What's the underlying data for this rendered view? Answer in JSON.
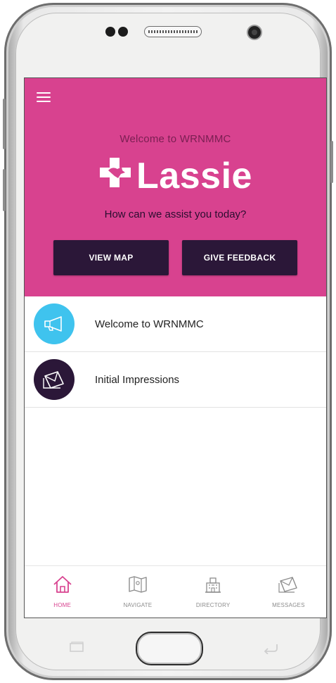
{
  "app": {
    "welcome_text": "Welcome to WRNMMC",
    "logo_text": "Lassie",
    "assist_text": "How can we assist you today?",
    "colors": {
      "hero": "#d8428f",
      "button": "#2b1738",
      "accent_blue": "#3fc3ee",
      "accent_purple": "#2b1738"
    }
  },
  "actions": {
    "view_map": "VIEW MAP",
    "give_feedback": "GIVE FEEDBACK"
  },
  "list": {
    "items": [
      {
        "label": "Welcome to WRNMMC",
        "icon": "megaphone-icon"
      },
      {
        "label": "Initial Impressions",
        "icon": "envelope-icon"
      }
    ]
  },
  "tabs": [
    {
      "label": "HOME",
      "icon": "home-icon",
      "active": true
    },
    {
      "label": "NAVIGATE",
      "icon": "map-icon",
      "active": false
    },
    {
      "label": "DIRECTORY",
      "icon": "building-icon",
      "active": false
    },
    {
      "label": "MESSAGES",
      "icon": "envelope-icon",
      "active": false
    }
  ]
}
